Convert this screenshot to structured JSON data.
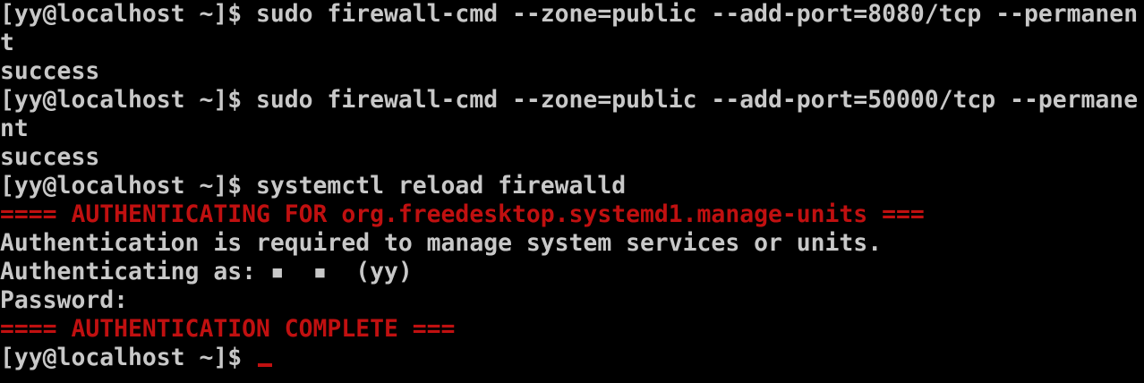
{
  "terminal": {
    "colors": {
      "background": "#000000",
      "text": "#c8c8c8",
      "alert": "#c01010",
      "cursor": "#c01010"
    },
    "lines": [
      {
        "text": "[yy@localhost ~]$ sudo firewall-cmd --zone=public --add-port=8080/tcp --permanen",
        "style": "normal"
      },
      {
        "text": "t",
        "style": "normal"
      },
      {
        "text": "success",
        "style": "normal"
      },
      {
        "text": "[yy@localhost ~]$ sudo firewall-cmd --zone=public --add-port=50000/tcp --permane",
        "style": "normal"
      },
      {
        "text": "nt",
        "style": "normal"
      },
      {
        "text": "success",
        "style": "normal"
      },
      {
        "text": "[yy@localhost ~]$ systemctl reload firewalld",
        "style": "normal"
      },
      {
        "text": "==== AUTHENTICATING FOR org.freedesktop.systemd1.manage-units ===",
        "style": "alert"
      },
      {
        "text": "Authentication is required to manage system services or units.",
        "style": "normal"
      },
      {
        "text": "Authenticating as: ▪  ▪  (yy)",
        "style": "normal"
      },
      {
        "text": "Password:",
        "style": "normal"
      },
      {
        "text": "==== AUTHENTICATION COMPLETE ===",
        "style": "alert"
      }
    ],
    "prompt": "[yy@localhost ~]$ "
  }
}
